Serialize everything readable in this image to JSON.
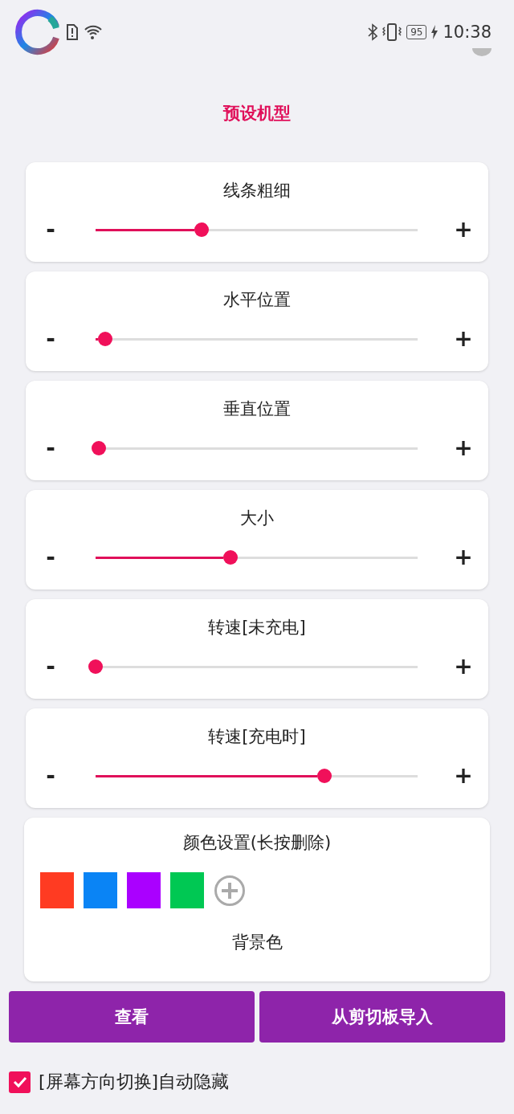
{
  "status_bar": {
    "battery": "95",
    "time": "10:38"
  },
  "title": "预设机型",
  "sliders": [
    {
      "label": "线条粗细",
      "minus": "-",
      "plus": "+",
      "level": 0.33
    },
    {
      "label": "水平位置",
      "minus": "-",
      "plus": "+",
      "level": 0.03
    },
    {
      "label": "垂直位置",
      "minus": "-",
      "plus": "+",
      "level": 0.01
    },
    {
      "label": "大小",
      "minus": "-",
      "plus": "+",
      "level": 0.42
    },
    {
      "label": "转速[未充电]",
      "minus": "-",
      "plus": "+",
      "level": 0.0
    },
    {
      "label": "转速[充电时]",
      "minus": "-",
      "plus": "+",
      "level": 0.71
    }
  ],
  "color_settings": {
    "title": "颜色设置(长按删除)",
    "colors": [
      {
        "color": "#ff3b22"
      },
      {
        "color": "#0a84f5"
      },
      {
        "color": "#aa00ff"
      },
      {
        "color": "#00c853"
      }
    ],
    "background_label": "背景色"
  },
  "buttons": [
    "查看",
    "从剪切板导入"
  ],
  "auto_hide": {
    "label": "[屏幕方向切换]自动隐藏",
    "checked": true
  }
}
